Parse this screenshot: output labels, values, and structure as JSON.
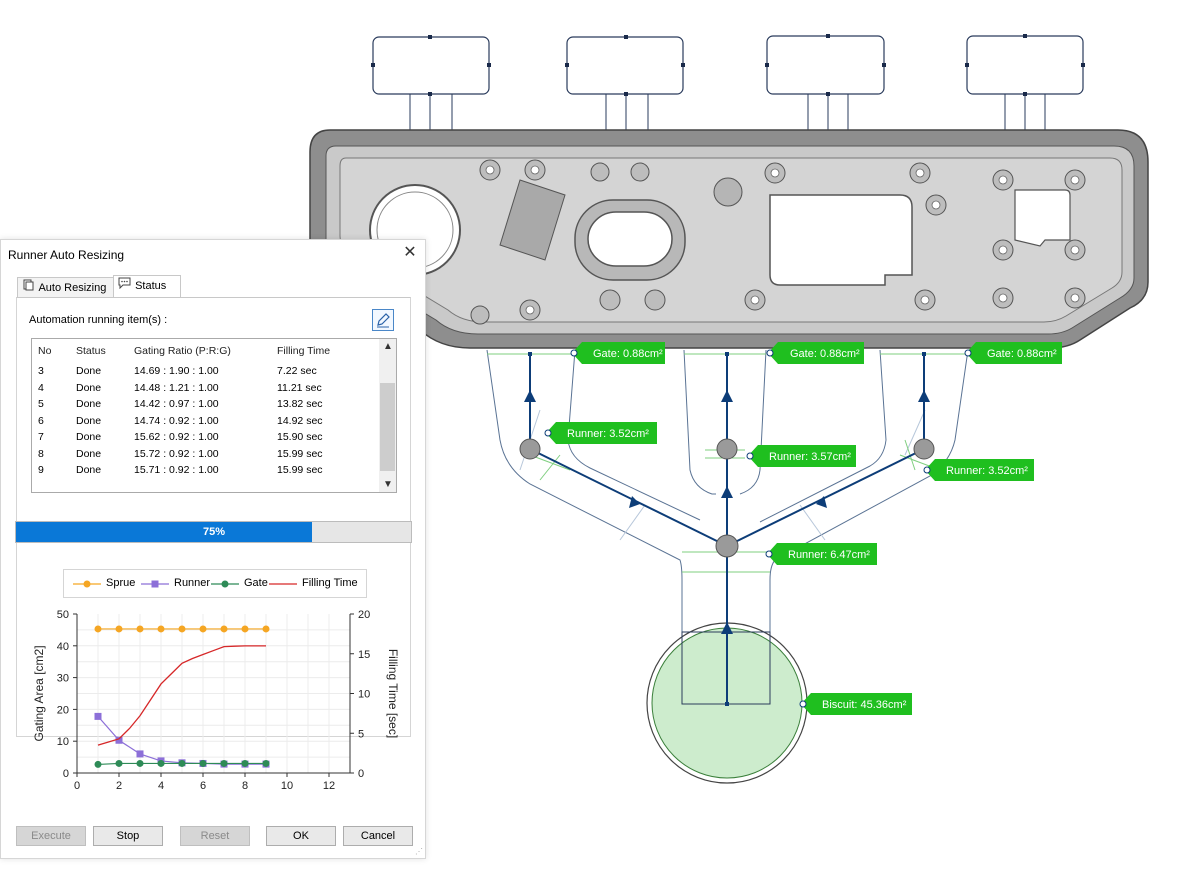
{
  "cad": {
    "gate_labels": [
      "Gate: 0.88cm²",
      "Gate: 0.88cm²",
      "Gate: 0.88cm²"
    ],
    "runner_labels": [
      "Runner: 3.52cm²",
      "Runner: 3.57cm²",
      "Runner: 3.52cm²",
      "Runner: 6.47cm²"
    ],
    "biscuit_label": "Biscuit: 45.36cm²",
    "colors": {
      "label_bg": "#1fbf1f",
      "runner_line": "#0d3d78",
      "biscuit_fill": "#cdeccd",
      "part_fill": "#c8c8c8"
    }
  },
  "dialog": {
    "title": "Runner Auto Resizing",
    "close_glyph": "✕",
    "tabs": [
      {
        "label": "Auto Resizing",
        "icon": "document-stack-icon"
      },
      {
        "label": "Status",
        "icon": "speech-bubble-icon"
      }
    ],
    "running_label": "Automation running item(s) :",
    "list": {
      "headers": [
        "No",
        "Status",
        "Gating Ratio (P:R:G)",
        "Filling Time"
      ],
      "rows": [
        {
          "no": "3",
          "status": "Done",
          "ratio": "14.69 : 1.90 : 1.00",
          "time": "7.22 sec"
        },
        {
          "no": "4",
          "status": "Done",
          "ratio": "14.48 : 1.21 : 1.00",
          "time": "11.21 sec"
        },
        {
          "no": "5",
          "status": "Done",
          "ratio": "14.42 : 0.97 : 1.00",
          "time": "13.82 sec"
        },
        {
          "no": "6",
          "status": "Done",
          "ratio": "14.74 : 0.92 : 1.00",
          "time": "14.92 sec"
        },
        {
          "no": "7",
          "status": "Done",
          "ratio": "15.62 : 0.92 : 1.00",
          "time": "15.90 sec"
        },
        {
          "no": "8",
          "status": "Done",
          "ratio": "15.72 : 0.92 : 1.00",
          "time": "15.99 sec"
        },
        {
          "no": "9",
          "status": "Done",
          "ratio": "15.71 : 0.92 : 1.00",
          "time": "15.99 sec"
        }
      ]
    },
    "progress": {
      "value": 0.75,
      "text": "75%"
    },
    "buttons": {
      "execute": "Execute",
      "stop": "Stop",
      "reset": "Reset",
      "ok": "OK",
      "cancel": "Cancel"
    }
  },
  "chart_data": {
    "type": "line",
    "series": [
      {
        "name": "Sprue",
        "axis": "left",
        "color": "#f5a623",
        "marker": "circle",
        "x": [
          1,
          2,
          3,
          4,
          5,
          6,
          7,
          8,
          9
        ],
        "y": [
          45.3,
          45.3,
          45.3,
          45.3,
          45.3,
          45.3,
          45.3,
          45.3,
          45.3
        ]
      },
      {
        "name": "Runner",
        "axis": "left",
        "color": "#8c6fd8",
        "marker": "square",
        "x": [
          1,
          2,
          3,
          4,
          5,
          6,
          7,
          8,
          9
        ],
        "y": [
          17.8,
          10.3,
          6.0,
          3.8,
          3.2,
          3.0,
          2.8,
          2.8,
          2.8
        ]
      },
      {
        "name": "Gate",
        "axis": "left",
        "color": "#2e8b57",
        "marker": "circle",
        "x": [
          1,
          2,
          3,
          4,
          5,
          6,
          7,
          8,
          9
        ],
        "y": [
          2.7,
          3.0,
          3.0,
          3.0,
          3.0,
          3.0,
          3.0,
          3.0,
          3.0
        ]
      },
      {
        "name": "Filling Time",
        "axis": "right",
        "color": "#d62728",
        "marker": "none",
        "x": [
          1,
          1.5,
          2,
          2.5,
          3,
          3.5,
          4,
          4.5,
          5,
          5.5,
          6,
          6.5,
          7,
          7.5,
          8,
          8.5,
          9
        ],
        "y": [
          3.5,
          3.9,
          4.3,
          5.6,
          7.2,
          9.2,
          11.2,
          12.5,
          13.8,
          14.4,
          14.9,
          15.4,
          15.9,
          15.95,
          15.99,
          15.99,
          15.99
        ]
      }
    ],
    "xlim": [
      0,
      13
    ],
    "ylim_left": [
      0,
      50
    ],
    "ylim_right": [
      0,
      20
    ],
    "xticks": [
      "0",
      "2",
      "4",
      "6",
      "8",
      "10",
      "12"
    ],
    "yticks_left": [
      "0",
      "10",
      "20",
      "30",
      "40",
      "50"
    ],
    "yticks_right": [
      "0",
      "5",
      "10",
      "15",
      "20"
    ],
    "ylabel_left": "Gating Area [cm2]",
    "ylabel_right": "Filling Time [sec]",
    "grid": true,
    "legend_position": "top"
  }
}
